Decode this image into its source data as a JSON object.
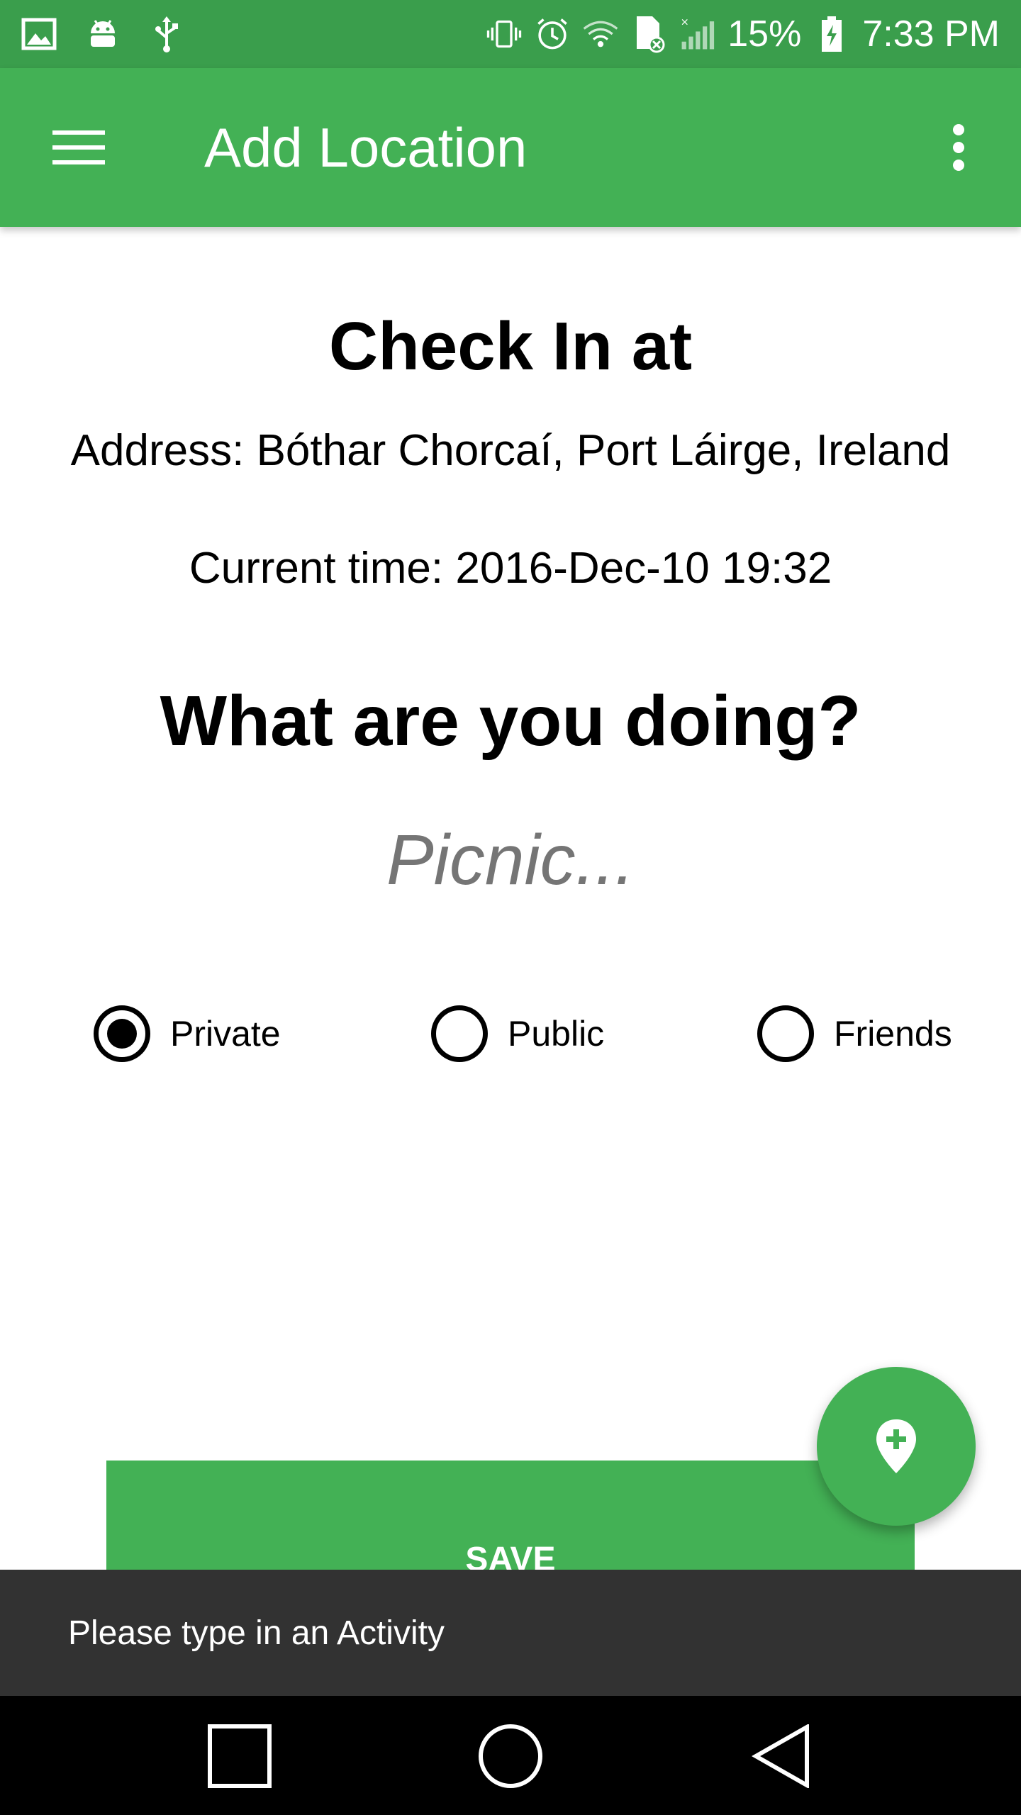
{
  "status_bar": {
    "battery": "15%",
    "time": "7:33 PM"
  },
  "toolbar": {
    "title": "Add Location"
  },
  "content": {
    "heading": "Check In at",
    "address": "Address: Bóthar Chorcaí, Port Láirge, Ireland",
    "time": "Current time: 2016-Dec-10 19:32",
    "question": "What are you doing?",
    "activity_placeholder": "Picnic..."
  },
  "visibility": {
    "options": [
      {
        "label": "Private",
        "selected": true
      },
      {
        "label": "Public",
        "selected": false
      },
      {
        "label": "Friends",
        "selected": false
      }
    ]
  },
  "save_label": "SAVE",
  "snackbar": {
    "message": "Please type in an Activity"
  },
  "colors": {
    "status_bar": "#3a9e4c",
    "toolbar": "#43b155",
    "snackbar": "#323232"
  },
  "icons": {
    "menu": "hamburger-icon",
    "overflow": "more-vert-icon",
    "fab": "add-location-icon"
  }
}
